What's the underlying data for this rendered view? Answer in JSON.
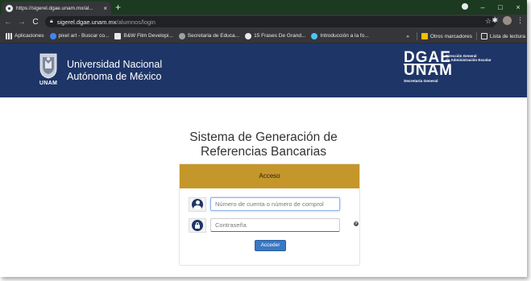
{
  "browser": {
    "tab_title": "https://sigerel.dgae.unam.mx/al...",
    "tab_close": "×",
    "new_tab": "+",
    "url_host": "sigerel.dgae.unam.mx",
    "url_path": "/alumnos/login",
    "nav": {
      "back": "←",
      "forward": "→",
      "reload": "C"
    },
    "window": {
      "minimize": "–",
      "maximize": "□",
      "close": "×"
    }
  },
  "bookmarks": {
    "items": [
      {
        "label": "Aplicaciones",
        "icon": "apps-grid-icon",
        "color": "#e8eaed"
      },
      {
        "label": "pixel art - Buscar co...",
        "icon": "google-icon",
        "color": "#4285f4"
      },
      {
        "label": "B&W Film Developi...",
        "icon": "film-icon",
        "color": "#e8eaed"
      },
      {
        "label": "Secretaria de Educa...",
        "icon": "sep-icon",
        "color": "#9aa0a6"
      },
      {
        "label": "15 Frases De Grand...",
        "icon": "quote-icon",
        "color": "#e8eaed"
      },
      {
        "label": "Introducción a la fo...",
        "icon": "bird-icon",
        "color": "#4fc3f7"
      }
    ],
    "overflow": "»",
    "other": "Otros marcadores",
    "reading_list": "Lista de lectura"
  },
  "header": {
    "unam_word": "UNAM",
    "university_line1": "Universidad Nacional",
    "university_line2": "Autónoma de México",
    "dgae_line1": "DGAE",
    "dgae_line2": "UNAM",
    "dgae_sub1": "Dirección General",
    "dgae_sub2": "de Administración Escolar",
    "dgae_secretaria": "Secretaría General",
    "bg_color": "#1e3568"
  },
  "main": {
    "title_line1": "Sistema de Generación de",
    "title_line2": "Referencias Bancarias",
    "card_header": "Acceso",
    "card_header_color": "#c5962a",
    "user_placeholder": "Número de cuenta o número de comprol",
    "password_placeholder": "Contraseña",
    "help_symbol": "?",
    "submit_label": "Acceder",
    "submit_color": "#3a78c3"
  }
}
